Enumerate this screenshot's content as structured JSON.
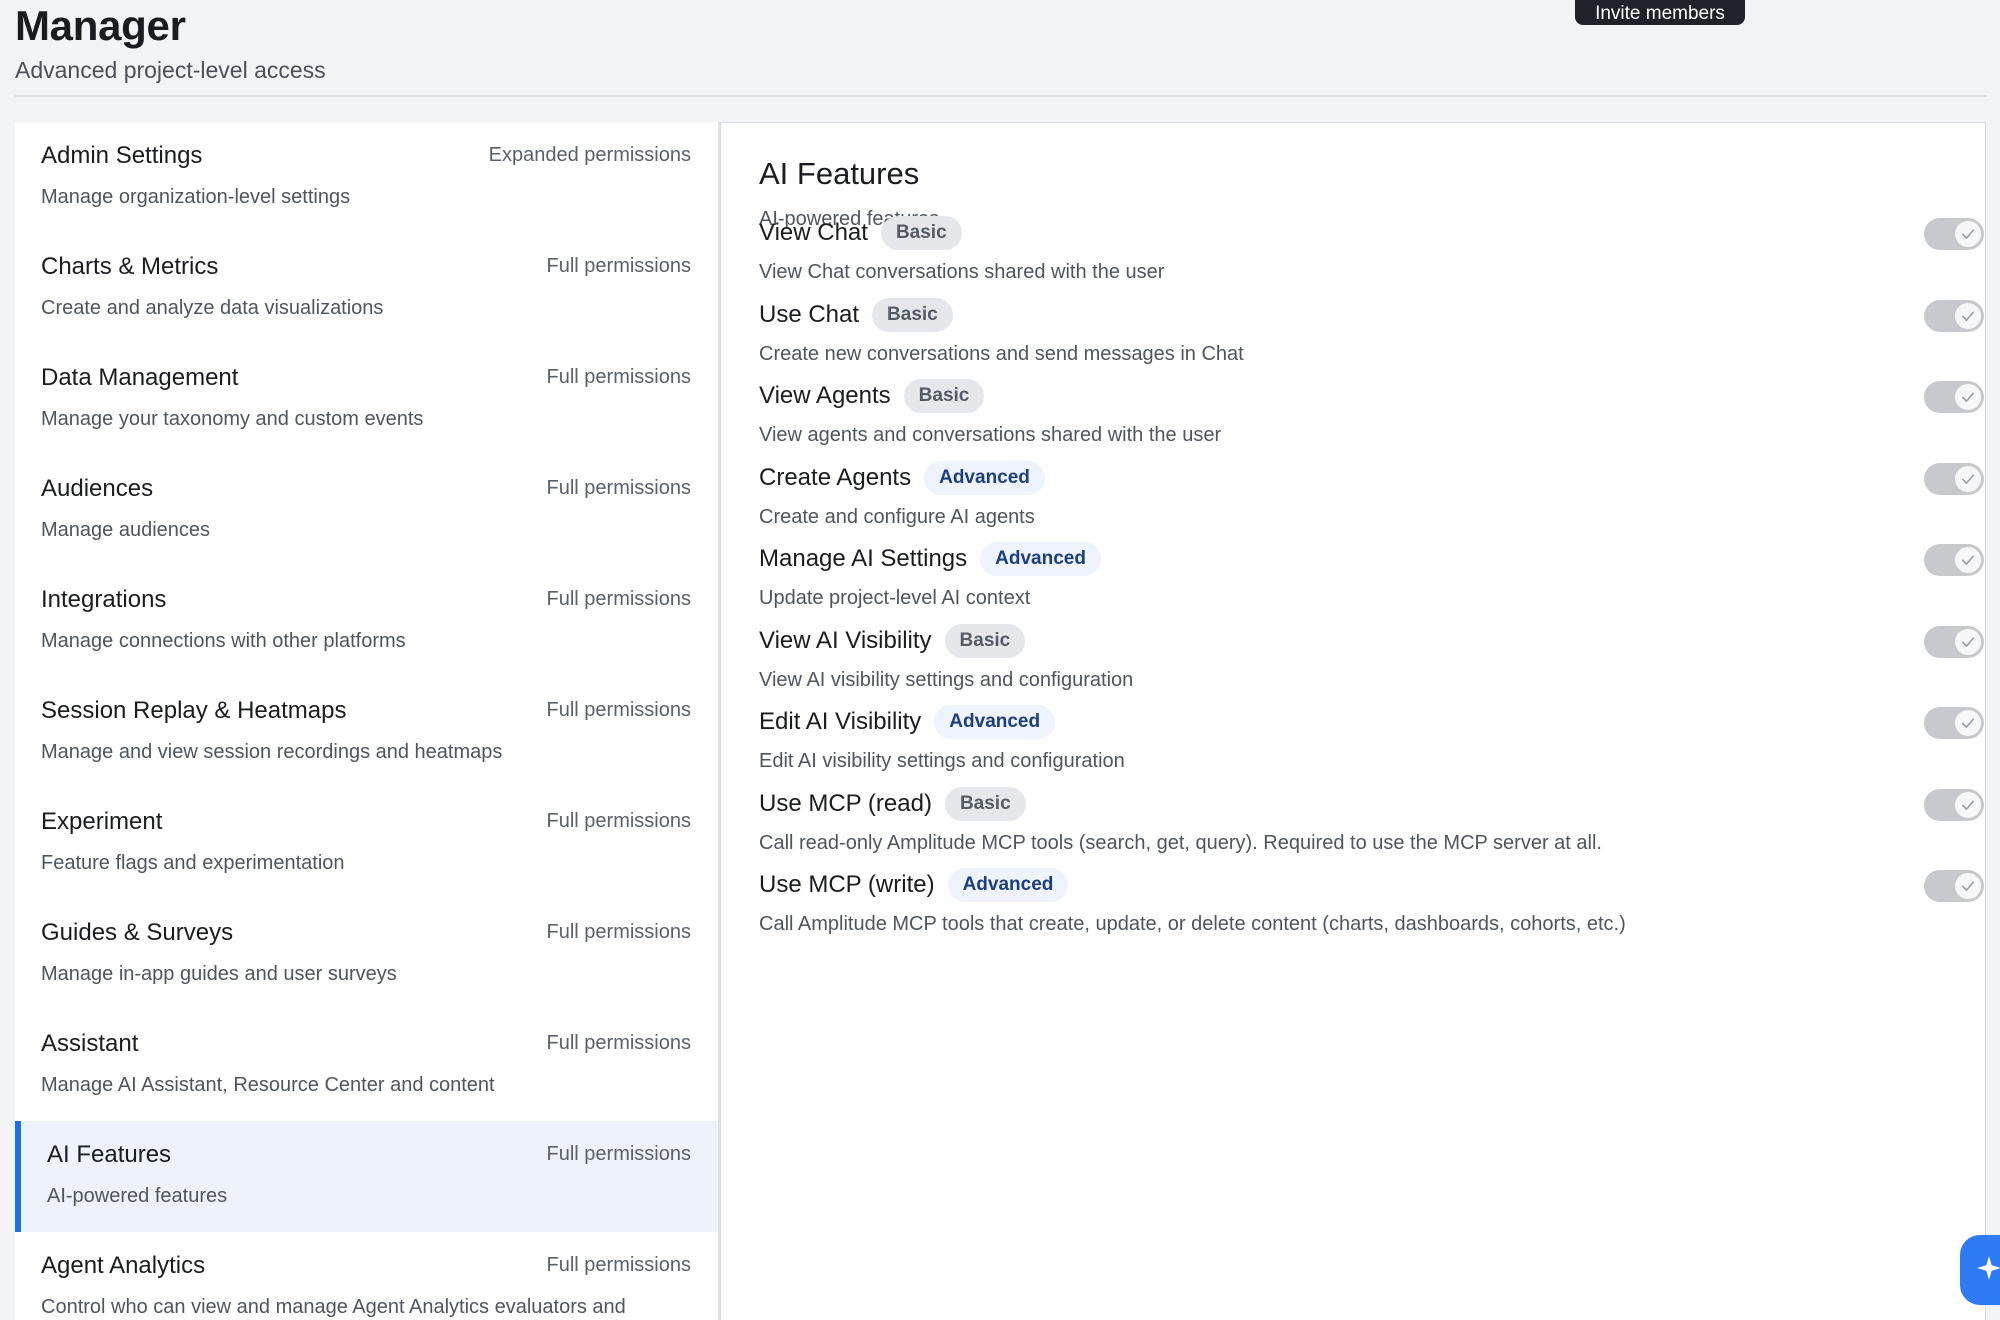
{
  "header": {
    "title": "Manager",
    "subtitle": "Advanced project-level access",
    "invite_button": "Invite members"
  },
  "categories": [
    {
      "name": "Admin Settings",
      "permission": "Expanded permissions",
      "description": "Manage organization-level settings",
      "active": false
    },
    {
      "name": "Charts & Metrics",
      "permission": "Full permissions",
      "description": "Create and analyze data visualizations",
      "active": false
    },
    {
      "name": "Data Management",
      "permission": "Full permissions",
      "description": "Manage your taxonomy and custom events",
      "active": false
    },
    {
      "name": "Audiences",
      "permission": "Full permissions",
      "description": "Manage audiences",
      "active": false
    },
    {
      "name": "Integrations",
      "permission": "Full permissions",
      "description": "Manage connections with other platforms",
      "active": false
    },
    {
      "name": "Session Replay & Heatmaps",
      "permission": "Full permissions",
      "description": "Manage and view session recordings and heatmaps",
      "active": false
    },
    {
      "name": "Experiment",
      "permission": "Full permissions",
      "description": "Feature flags and experimentation",
      "active": false
    },
    {
      "name": "Guides & Surveys",
      "permission": "Full permissions",
      "description": "Manage in-app guides and user surveys",
      "active": false
    },
    {
      "name": "Assistant",
      "permission": "Full permissions",
      "description": "Manage AI Assistant, Resource Center and content",
      "active": false
    },
    {
      "name": "AI Features",
      "permission": "Full permissions",
      "description": "AI-powered features",
      "active": true
    },
    {
      "name": "Agent Analytics",
      "permission": "Full permissions",
      "description": "Control who can view and manage Agent Analytics evaluators and",
      "active": false
    }
  ],
  "detail": {
    "title": "AI Features",
    "subtitle": "AI-powered features",
    "permissions": [
      {
        "name": "View Chat",
        "badge": "Basic",
        "level": "basic",
        "description": "View Chat conversations shared with the user",
        "enabled": true
      },
      {
        "name": "Use Chat",
        "badge": "Basic",
        "level": "basic",
        "description": "Create new conversations and send messages in Chat",
        "enabled": true
      },
      {
        "name": "View Agents",
        "badge": "Basic",
        "level": "basic",
        "description": "View agents and conversations shared with the user",
        "enabled": true
      },
      {
        "name": "Create Agents",
        "badge": "Advanced",
        "level": "advanced",
        "description": "Create and configure AI agents",
        "enabled": true
      },
      {
        "name": "Manage AI Settings",
        "badge": "Advanced",
        "level": "advanced",
        "description": "Update project-level AI context",
        "enabled": true
      },
      {
        "name": "View AI Visibility",
        "badge": "Basic",
        "level": "basic",
        "description": "View AI visibility settings and configuration",
        "enabled": true
      },
      {
        "name": "Edit AI Visibility",
        "badge": "Advanced",
        "level": "advanced",
        "description": "Edit AI visibility settings and configuration",
        "enabled": true
      },
      {
        "name": "Use MCP (read)",
        "badge": "Basic",
        "level": "basic",
        "description": "Call read-only Amplitude MCP tools (search, get, query). Required to use the MCP server at all.",
        "enabled": true
      },
      {
        "name": "Use MCP (write)",
        "badge": "Advanced",
        "level": "advanced",
        "description": "Call Amplitude MCP tools that create, update, or delete content (charts, dashboards, cohorts, etc.)",
        "enabled": true
      }
    ]
  },
  "colors": {
    "accent": "#1f6fe5",
    "active_row_bg": "#edf2fb",
    "toggle_bg": "#c7c9cd",
    "advanced_badge_text": "#1b3f82"
  },
  "icons": {
    "toggle": "check-icon",
    "assistant_fab": "sparkle-icon"
  }
}
